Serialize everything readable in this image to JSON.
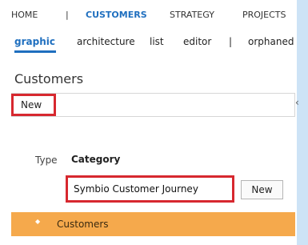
{
  "top_nav": {
    "items": [
      "HOME",
      "|",
      "CUSTOMERS",
      "STRATEGY",
      "PROJECTS"
    ],
    "active": "CUSTOMERS"
  },
  "sub_nav": {
    "items": [
      "graphic",
      "architecture",
      "list",
      "editor",
      "|",
      "orphaned"
    ],
    "active": "graphic"
  },
  "page": {
    "title": "Customers"
  },
  "new_tab": {
    "label": "New"
  },
  "form": {
    "type_label": "Type",
    "type_value": "Category",
    "journey_value": "Symbio Customer Journey",
    "new_button_label": "New"
  },
  "tree": {
    "items": [
      {
        "label": "Customers"
      }
    ]
  },
  "colors": {
    "accent": "#1f6fbf",
    "highlight_border": "#d7282f",
    "selected_row": "#f5a94c",
    "background": "#cde3f6"
  },
  "icons": {
    "collapse": "chevron-left-icon",
    "tree_bullet": "bullet-icon"
  }
}
